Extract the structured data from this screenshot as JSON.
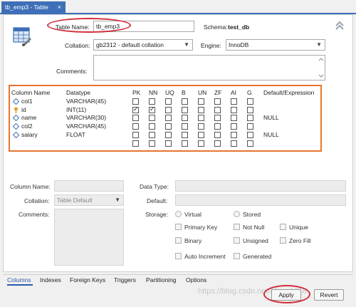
{
  "tab": {
    "title": "tb_emp3 - Table",
    "close": "×"
  },
  "header": {
    "table_name_label": "Table Name:",
    "table_name_value": "tb_emp3",
    "schema_label": "Schema:",
    "schema_value": "test_db",
    "collation_label": "Collation:",
    "collation_value": "gb2312 - default collation",
    "engine_label": "Engine:",
    "engine_value": "InnoDB",
    "comments_label": "Comments:"
  },
  "grid": {
    "columns": [
      "Column Name",
      "Datatype",
      "PK",
      "NN",
      "UQ",
      "B",
      "UN",
      "ZF",
      "AI",
      "G",
      "Default/Expression"
    ],
    "rows": [
      {
        "name": "col1",
        "type": "VARCHAR(45)",
        "pk": false,
        "nn": false,
        "default": ""
      },
      {
        "name": "id",
        "type": "INT(11)",
        "pk": true,
        "nn": true,
        "default": ""
      },
      {
        "name": "name",
        "type": "VARCHAR(30)",
        "pk": false,
        "nn": false,
        "default": "NULL"
      },
      {
        "name": "col2",
        "type": "VARCHAR(45)",
        "pk": false,
        "nn": false,
        "default": ""
      },
      {
        "name": "salary",
        "type": "FLOAT",
        "pk": false,
        "nn": false,
        "default": "NULL"
      }
    ]
  },
  "details": {
    "column_name_label": "Column Name:",
    "data_type_label": "Data Type:",
    "collation_label": "Collation:",
    "collation_value": "Table Default",
    "default_label": "Default:",
    "comments_label": "Comments:",
    "storage_label": "Storage:",
    "virtual": "Virtual",
    "stored": "Stored",
    "primary_key": "Primary Key",
    "not_null": "Not Null",
    "unique": "Unique",
    "binary": "Binary",
    "unsigned": "Unsigned",
    "zero_fill": "Zero Fill",
    "auto_increment": "Auto Increment",
    "generated": "Generated"
  },
  "bottom_tabs": [
    "Columns",
    "Indexes",
    "Foreign Keys",
    "Triggers",
    "Partitioning",
    "Options"
  ],
  "buttons": {
    "apply": "Apply",
    "revert": "Revert"
  },
  "watermark": "https://blog.csdn.net/Miss_ME8",
  "colors": {
    "accent": "#3e6fb8",
    "highlight_frame": "#e8742f",
    "annotation": "#d22b3a"
  }
}
